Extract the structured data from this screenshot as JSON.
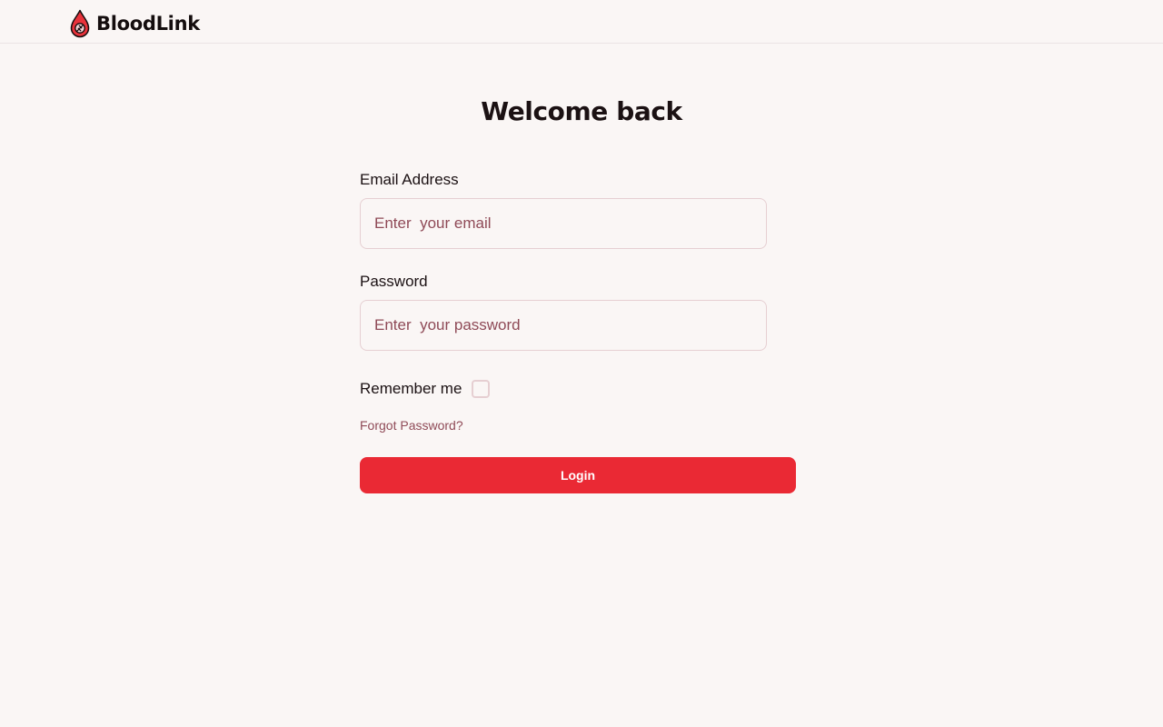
{
  "header": {
    "brand_name": "BloodLink",
    "logo_icon": "blood-drop-icon"
  },
  "main": {
    "title": "Welcome back",
    "email": {
      "label": "Email Address",
      "placeholder": "Enter  your email",
      "value": ""
    },
    "password": {
      "label": "Password",
      "placeholder": "Enter  your password",
      "value": ""
    },
    "remember_me": {
      "label": "Remember me",
      "checked": false
    },
    "forgot_password_label": "Forgot Password?",
    "login_label": "Login"
  },
  "colors": {
    "background": "#faf6f5",
    "accent": "#ea2934",
    "input_border": "#e6cfd2",
    "muted_text": "#8f4a57",
    "text": "#1b1113"
  }
}
